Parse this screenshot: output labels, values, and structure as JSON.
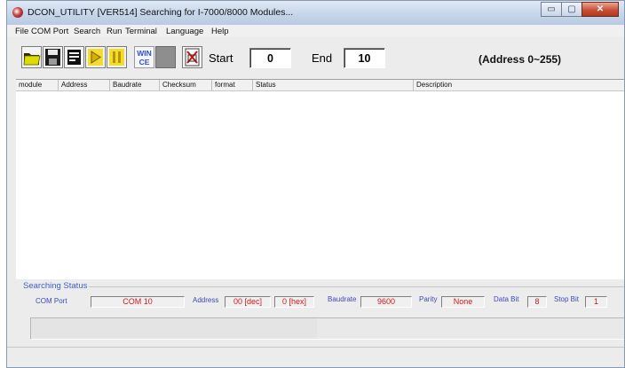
{
  "window": {
    "title": "DCON_UTILITY [VER514] Searching for I-7000/8000 Modules..."
  },
  "caption_buttons": {
    "minimize": "▭",
    "maximize": "▢",
    "close": "✕"
  },
  "menu": [
    "File",
    "COM Port",
    "Search",
    "Run",
    "Terminal",
    "Language",
    "Help"
  ],
  "toolbar": {
    "buttons": [
      "open-folder",
      "save-disk",
      "list-document",
      "run-play",
      "pause",
      "wince",
      "blank",
      "stop-search"
    ],
    "wince_top": "WIN",
    "wince_bottom": "CE",
    "start_label": "Start",
    "start_value": "0",
    "end_label": "End",
    "end_value": "10",
    "address_range": "(Address 0~255)"
  },
  "list": {
    "columns": [
      "module",
      "Address",
      "Baudrate",
      "Checksum",
      "format",
      "Status",
      "Description"
    ],
    "rows": []
  },
  "status": {
    "title": "Searching Status",
    "com_port_label": "COM Port",
    "com_port_value": "COM 10",
    "address_label": "Address",
    "address_dec": "00 [dec]",
    "address_hex": "0 [hex]",
    "baudrate_label": "Baudrate",
    "baudrate_value": "9600",
    "parity_label": "Parity",
    "parity_value": "None",
    "databit_label": "Data Bit",
    "databit_value": "8",
    "stopbit_label": "Stop Bit",
    "stopbit_value": "1"
  },
  "progress": {
    "fraction": 0.48
  },
  "colors": {
    "status_label": "#3b4ab8",
    "status_value": "#d21818",
    "group_title": "#3a5ed0"
  }
}
